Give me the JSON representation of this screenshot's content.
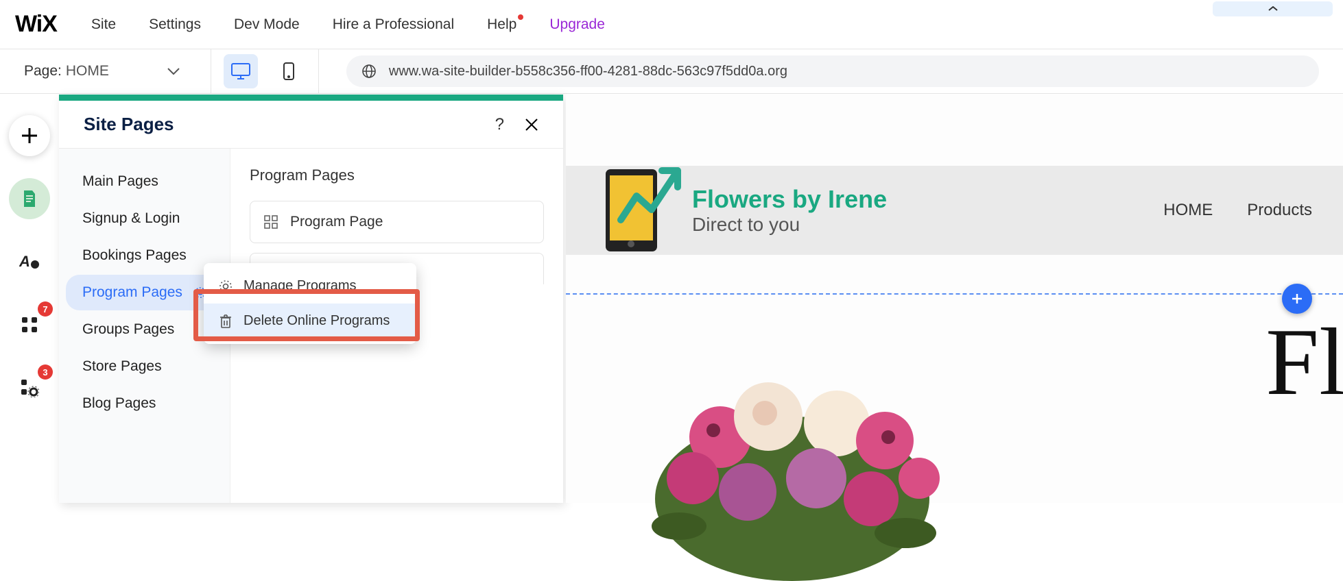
{
  "topbar": {
    "logo": "WiX",
    "menu": {
      "site": "Site",
      "settings": "Settings",
      "devmode": "Dev Mode",
      "hire": "Hire a Professional",
      "help": "Help",
      "upgrade": "Upgrade"
    }
  },
  "secondbar": {
    "page_label": "Page:",
    "page_name": "HOME",
    "url": "www.wa-site-builder-b558c356-ff00-4281-88dc-563c97f5dd0a.org"
  },
  "rail": {
    "badge_apps": "7",
    "badge_settings": "3"
  },
  "panel": {
    "title": "Site Pages",
    "section_title": "Program Pages",
    "sidebar": {
      "items": [
        {
          "label": "Main Pages"
        },
        {
          "label": "Signup & Login"
        },
        {
          "label": "Bookings Pages"
        },
        {
          "label": "Program Pages"
        },
        {
          "label": "Groups Pages"
        },
        {
          "label": "Store Pages"
        },
        {
          "label": "Blog Pages"
        }
      ]
    },
    "page_item": "Program Page",
    "context_menu": {
      "manage": "Manage Programs",
      "delete": "Delete Online Programs"
    }
  },
  "site": {
    "title": "Flowers by Irene",
    "subtitle": "Direct to you",
    "nav": {
      "home": "HOME",
      "products": "Products"
    },
    "bigtext": "Fl"
  }
}
